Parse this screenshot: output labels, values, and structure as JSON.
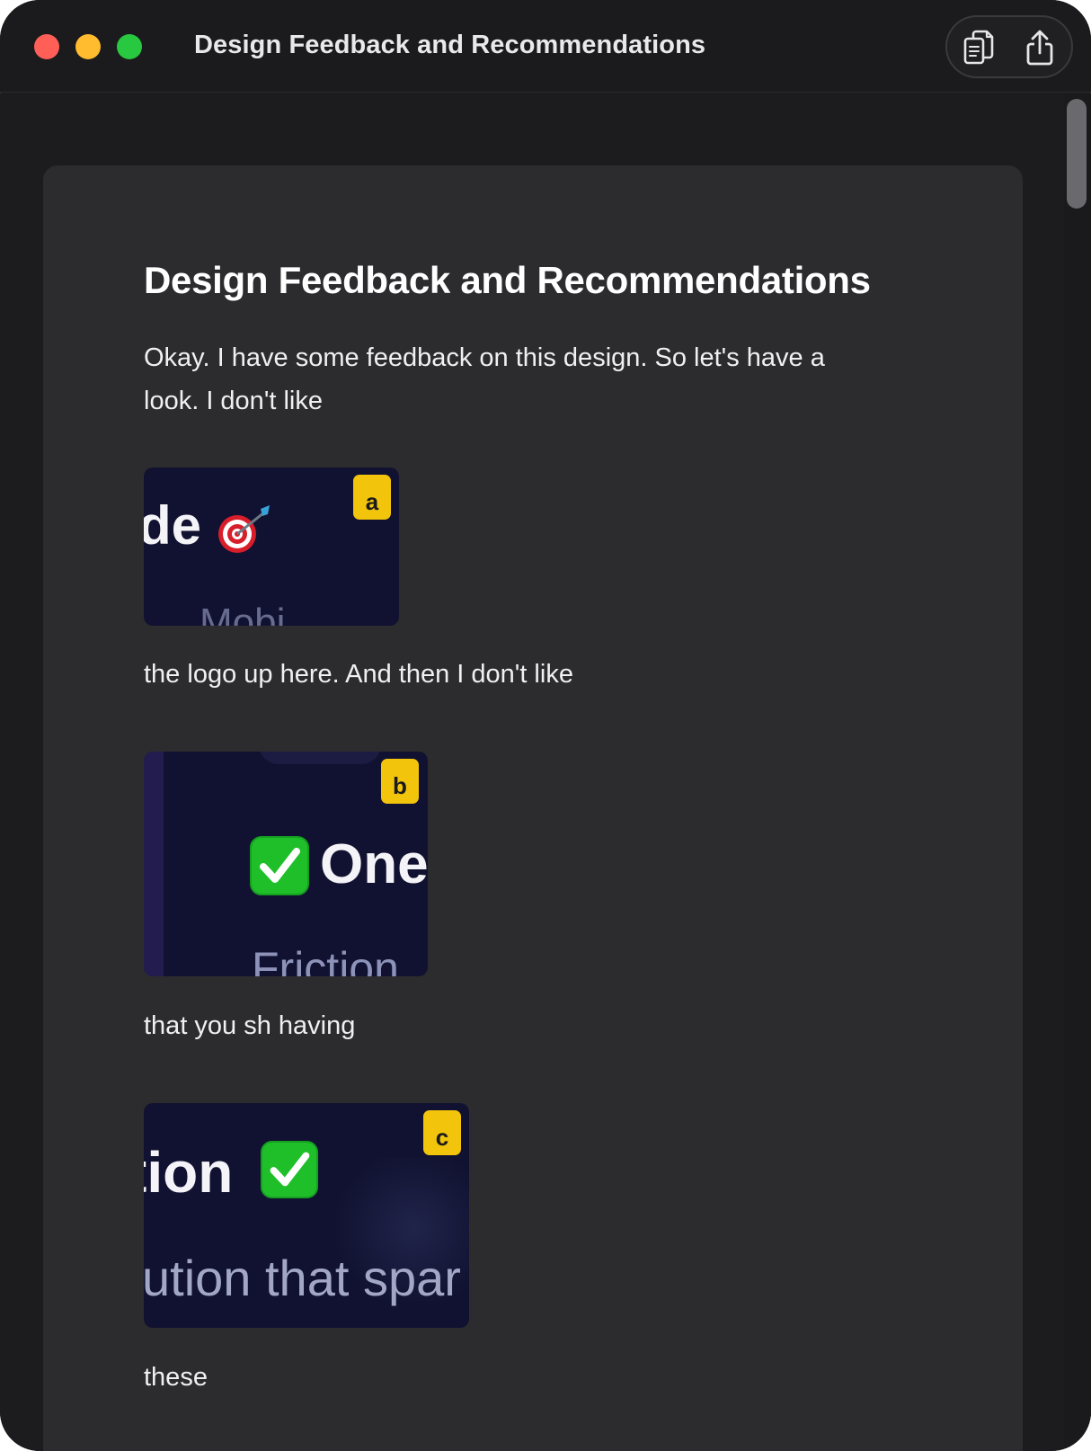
{
  "window": {
    "title": "Design Feedback and Recommendations"
  },
  "toolbar": {
    "copy_icon": "copy-icon",
    "share_icon": "share-icon"
  },
  "document": {
    "title": "Design Feedback and Recommendations",
    "paragraphs": [
      "Okay. I have some feedback on this design. So let's have a look. I don't like",
      "the logo up here. And then I don't like",
      "that you sh having",
      "these"
    ],
    "screenshots": [
      {
        "badge": "a",
        "visible_text": "de",
        "faint_text": "Mobi",
        "emoji": "target-icon"
      },
      {
        "badge": "b",
        "visible_text": "One",
        "faint_text": "Friction",
        "emoji": "check-icon"
      },
      {
        "badge": "c",
        "visible_text": "tion",
        "faint_text": "ution that spar",
        "emoji": "check-icon"
      }
    ]
  },
  "colors": {
    "window_bg": "#1c1c1e",
    "card_bg": "#2c2c2e",
    "badge": "#f2c40c",
    "thumb_bg": "#111231",
    "close": "#ff5f57",
    "minimize": "#febc2e",
    "maximize": "#28c840"
  }
}
